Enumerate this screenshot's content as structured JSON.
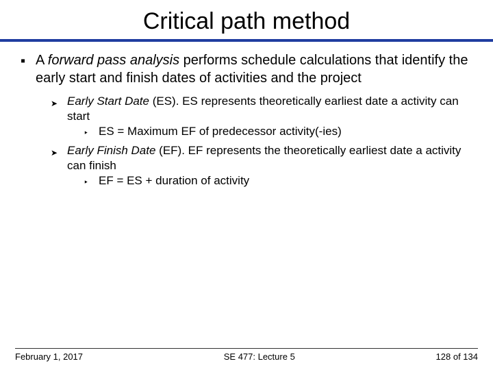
{
  "title": "Critical path method",
  "body": {
    "lead_pre_italic": "A ",
    "lead_italic": "forward pass analysis",
    "lead_post": " performs schedule calculations that identify the early start and finish dates of activities and the project",
    "items": [
      {
        "pre_italic": "Early Start Date",
        "post": " (ES). ES represents theoretically earliest date a activity can start",
        "sub": "ES = Maximum EF of predecessor activity(-ies)"
      },
      {
        "pre_italic": "Early Finish Date",
        "post": " (EF). EF represents the theoretically earliest date a activity can finish",
        "sub": "EF = ES + duration of activity"
      }
    ]
  },
  "footer": {
    "date": "February 1, 2017",
    "center": "SE 477: Lecture 5",
    "page": "128 of 134"
  }
}
